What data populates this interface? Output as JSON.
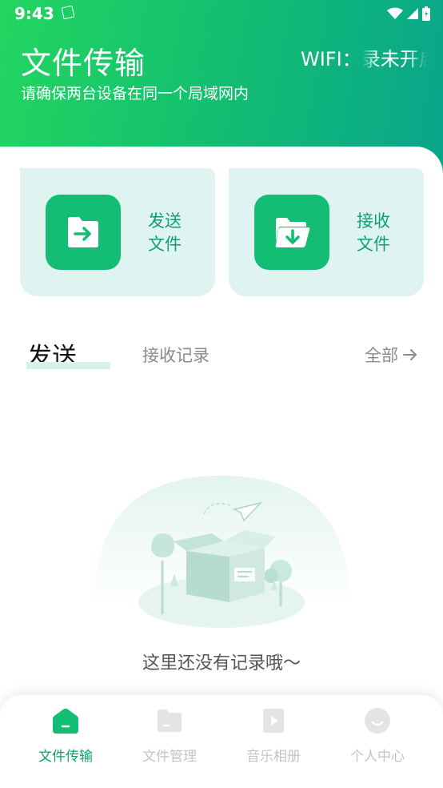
{
  "status_bar": {
    "time": "9:43"
  },
  "header": {
    "title": "文件传输",
    "subtitle": "请确保两台设备在同一个局域网内",
    "wifi_label": "WIFI：",
    "wifi_value": "录未开启"
  },
  "cards": {
    "send": {
      "label": "发送文件",
      "icon": "folder-arrow-right-icon"
    },
    "receive": {
      "label": "接收文件",
      "icon": "folder-arrow-down-icon"
    }
  },
  "tabs": {
    "active": "发送...",
    "receive": "接收记录",
    "all": "全部"
  },
  "empty_state": {
    "text": "这里还没有记录哦～"
  },
  "bottom_nav": [
    {
      "label": "文件传输",
      "icon": "home-icon",
      "active": true
    },
    {
      "label": "文件管理",
      "icon": "folder-icon",
      "active": false
    },
    {
      "label": "音乐相册",
      "icon": "media-icon",
      "active": false
    },
    {
      "label": "个人中心",
      "icon": "profile-icon",
      "active": false
    }
  ],
  "colors": {
    "brand_green": "#14bd74",
    "label_green": "#0e9f72",
    "card_bg": "#dff4f0"
  }
}
